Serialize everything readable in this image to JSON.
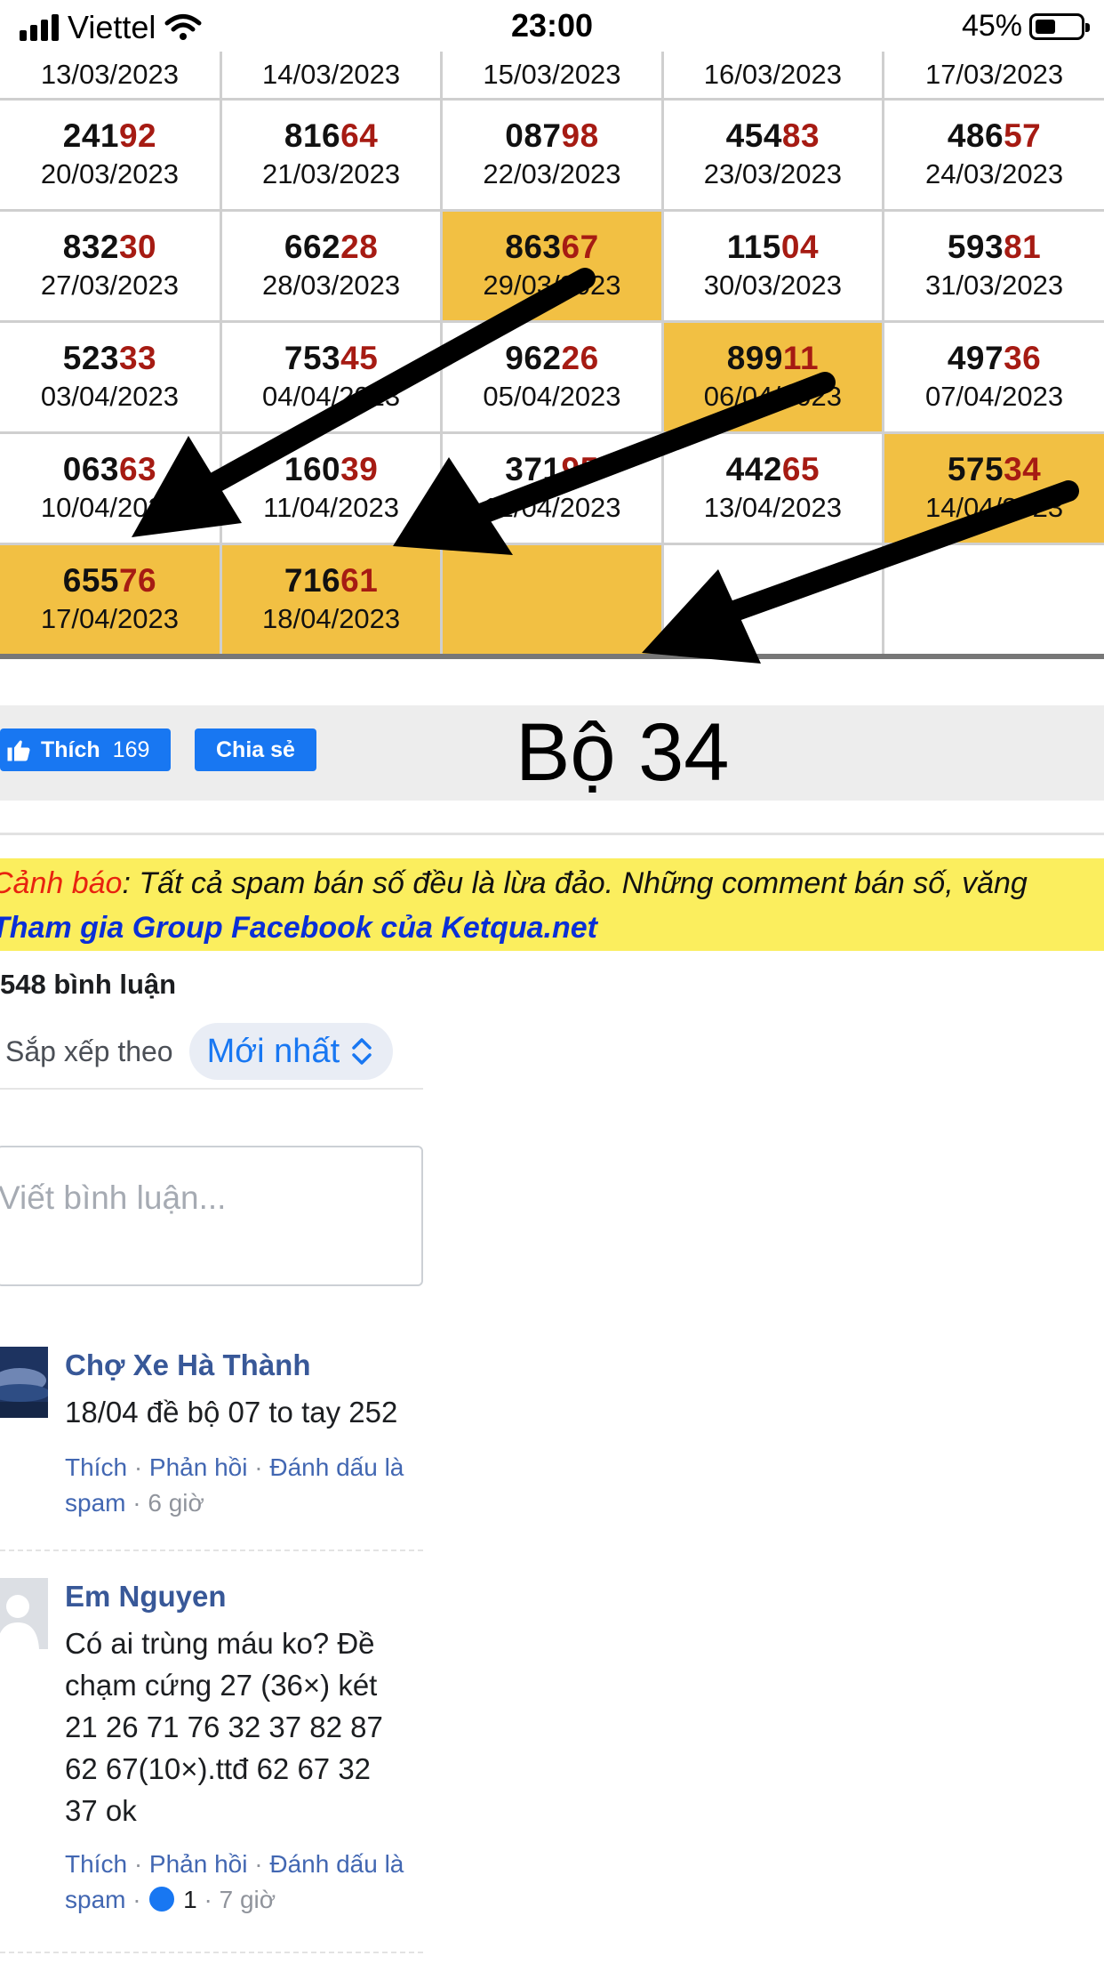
{
  "status": {
    "carrier": "Viettel",
    "time": "23:00",
    "battery": "45%",
    "battery_level": 0.45
  },
  "results": {
    "header_dates": [
      "13/03/2023",
      "14/03/2023",
      "15/03/2023",
      "16/03/2023",
      "17/03/2023"
    ],
    "rows": [
      [
        {
          "prefix": "241",
          "suffix": "92",
          "date": "20/03/2023",
          "highlight": false
        },
        {
          "prefix": "816",
          "suffix": "64",
          "date": "21/03/2023",
          "highlight": false
        },
        {
          "prefix": "087",
          "suffix": "98",
          "date": "22/03/2023",
          "highlight": false
        },
        {
          "prefix": "454",
          "suffix": "83",
          "date": "23/03/2023",
          "highlight": false
        },
        {
          "prefix": "486",
          "suffix": "57",
          "date": "24/03/2023",
          "highlight": false
        }
      ],
      [
        {
          "prefix": "832",
          "suffix": "30",
          "date": "27/03/2023",
          "highlight": false
        },
        {
          "prefix": "662",
          "suffix": "28",
          "date": "28/03/2023",
          "highlight": false
        },
        {
          "prefix": "863",
          "suffix": "67",
          "date": "29/03/2023",
          "highlight": true
        },
        {
          "prefix": "115",
          "suffix": "04",
          "date": "30/03/2023",
          "highlight": false
        },
        {
          "prefix": "593",
          "suffix": "81",
          "date": "31/03/2023",
          "highlight": false
        }
      ],
      [
        {
          "prefix": "523",
          "suffix": "33",
          "date": "03/04/2023",
          "highlight": false
        },
        {
          "prefix": "753",
          "suffix": "45",
          "date": "04/04/2023",
          "highlight": false
        },
        {
          "prefix": "962",
          "suffix": "26",
          "date": "05/04/2023",
          "highlight": false
        },
        {
          "prefix": "899",
          "suffix": "11",
          "date": "06/04/2023",
          "highlight": true
        },
        {
          "prefix": "497",
          "suffix": "36",
          "date": "07/04/2023",
          "highlight": false
        }
      ],
      [
        {
          "prefix": "063",
          "suffix": "63",
          "date": "10/04/2023",
          "highlight": false
        },
        {
          "prefix": "160",
          "suffix": "39",
          "date": "11/04/2023",
          "highlight": false
        },
        {
          "prefix": "371",
          "suffix": "95",
          "date": "12/04/2023",
          "highlight": false
        },
        {
          "prefix": "442",
          "suffix": "65",
          "date": "13/04/2023",
          "highlight": false
        },
        {
          "prefix": "575",
          "suffix": "34",
          "date": "14/04/2023",
          "highlight": true
        }
      ],
      [
        {
          "prefix": "655",
          "suffix": "76",
          "date": "17/04/2023",
          "highlight": true
        },
        {
          "prefix": "716",
          "suffix": "61",
          "date": "18/04/2023",
          "highlight": true
        },
        {
          "prefix": "",
          "suffix": "",
          "date": "",
          "highlight": true
        },
        {
          "prefix": "",
          "suffix": "",
          "date": "",
          "highlight": false
        },
        {
          "prefix": "",
          "suffix": "",
          "date": "",
          "highlight": false
        }
      ]
    ]
  },
  "social": {
    "like_label": "Thích",
    "like_count": "169",
    "share_label": "Chia sẻ"
  },
  "bo_title": "Bộ 34",
  "warning": {
    "label": "Cảnh báo",
    "text": ": Tất cả spam bán số đều là lừa đảo. Những comment bán số, văng",
    "group_link": "Tham gia Group Facebook của Ketqua.net"
  },
  "comments": {
    "count_label": "548 bình luận",
    "sort_label": "Sắp xếp theo",
    "sort_value": "Mới nhất",
    "input_placeholder": "Viết bình luận...",
    "items": [
      {
        "author": "Chợ Xe Hà Thành",
        "lines": [
          "18/04 đề bộ 07 to tay 252"
        ],
        "like": "Thích",
        "reply": "Phản hồi",
        "spam_line1": "Đánh dấu là",
        "spam_line2": "spam",
        "time": "6 giờ",
        "reactions": ""
      },
      {
        "author": "Em Nguyen",
        "lines": [
          "Có ai trùng máu ko? Đề",
          "chạm cứng 27 (36×) két",
          "21 26 71 76 32 37 82 87",
          "62 67(10×).ttđ 62 67 32",
          "37 ok"
        ],
        "like": "Thích",
        "reply": "Phản hồi",
        "spam_line1": "Đánh dấu là",
        "spam_line2": "spam",
        "time": "7 giờ",
        "reactions": "1"
      }
    ]
  },
  "colors": {
    "highlight": "#f2c043",
    "suffix_red": "#a61b13",
    "facebook_blue": "#1877f2",
    "warning_bg": "#fbee5e",
    "link_blue": "#4267b2"
  },
  "icons": [
    "signal-icon",
    "wifi-icon",
    "battery-icon",
    "thumbs-up-icon",
    "chevron-updown-icon",
    "avatar-icon",
    "like-reaction-icon",
    "arrow-annotation-icon"
  ]
}
